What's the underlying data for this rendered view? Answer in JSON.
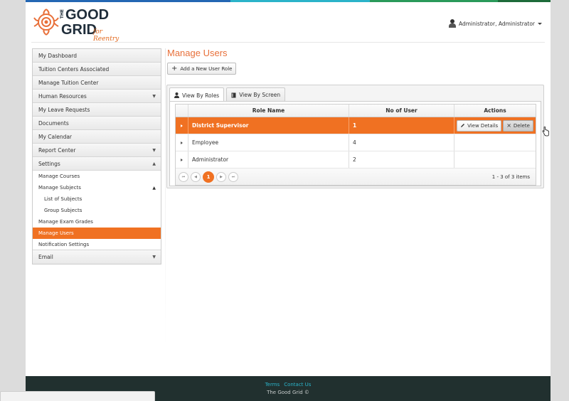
{
  "colors": {
    "accent": "#f07122",
    "title": "#e8703a",
    "footer_bg": "#21302f",
    "footer_link": "#2bb3c9"
  },
  "header": {
    "logo": {
      "the": "THE",
      "good": "GOOD",
      "grid": "GRID",
      "tagline": "for Reentry"
    },
    "user_name": "Administrator, Administrator"
  },
  "sidebar": {
    "items": [
      {
        "label": "My Dashboard"
      },
      {
        "label": "Tuition Centers Associated"
      },
      {
        "label": "Manage Tuition Center"
      },
      {
        "label": "Human Resources",
        "arrow": "▼"
      },
      {
        "label": "My Leave Requests"
      },
      {
        "label": "Documents"
      },
      {
        "label": "My Calendar"
      },
      {
        "label": "Report Center",
        "arrow": "▼"
      },
      {
        "label": "Settings",
        "arrow": "▲"
      }
    ],
    "settings_children": [
      {
        "label": "Manage Courses"
      },
      {
        "label": "Manage Subjects",
        "arrow": "▲"
      },
      {
        "label": "List of Subjects"
      },
      {
        "label": "Group Subjects"
      },
      {
        "label": "Manage Exam Grades"
      },
      {
        "label": "Manage Users"
      },
      {
        "label": "Notification Settings"
      }
    ],
    "email": {
      "label": "Email",
      "arrow": "▼"
    }
  },
  "main": {
    "title": "Manage Users",
    "add_button": "Add a New User Role",
    "tabs": [
      {
        "label": "View By Roles"
      },
      {
        "label": "View By Screen"
      }
    ],
    "grid": {
      "columns": [
        "Role Name",
        "No of User",
        "Actions"
      ],
      "rows": [
        {
          "role": "District Supervisor",
          "count": "1"
        },
        {
          "role": "Employee",
          "count": "4"
        },
        {
          "role": "Administrator",
          "count": "2"
        }
      ],
      "view_details": "View Details",
      "delete": "Delete",
      "pager": {
        "first": "⏮",
        "prev": "◀",
        "current": "1",
        "next": "▶",
        "last": "⏭",
        "summary": "1 - 3 of 3 items"
      }
    }
  },
  "footer": {
    "terms": "Terms",
    "contact": "Contact Us",
    "copyright": "The Good Grid ©"
  }
}
